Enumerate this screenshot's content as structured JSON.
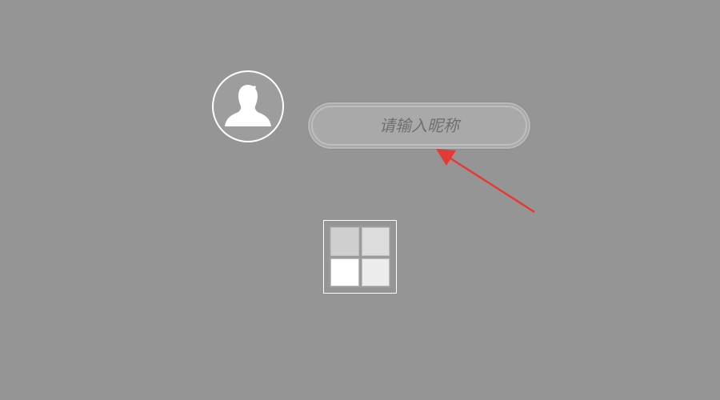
{
  "profile": {
    "avatar_icon": "user-silhouette-icon",
    "nickname_placeholder": "请输入昵称",
    "nickname_value": ""
  },
  "annotation": {
    "arrow_icon": "red-arrow-icon",
    "arrow_color": "#e53935"
  },
  "grid_button": {
    "icon": "grid-squares-icon"
  },
  "colors": {
    "background": "#959595"
  }
}
